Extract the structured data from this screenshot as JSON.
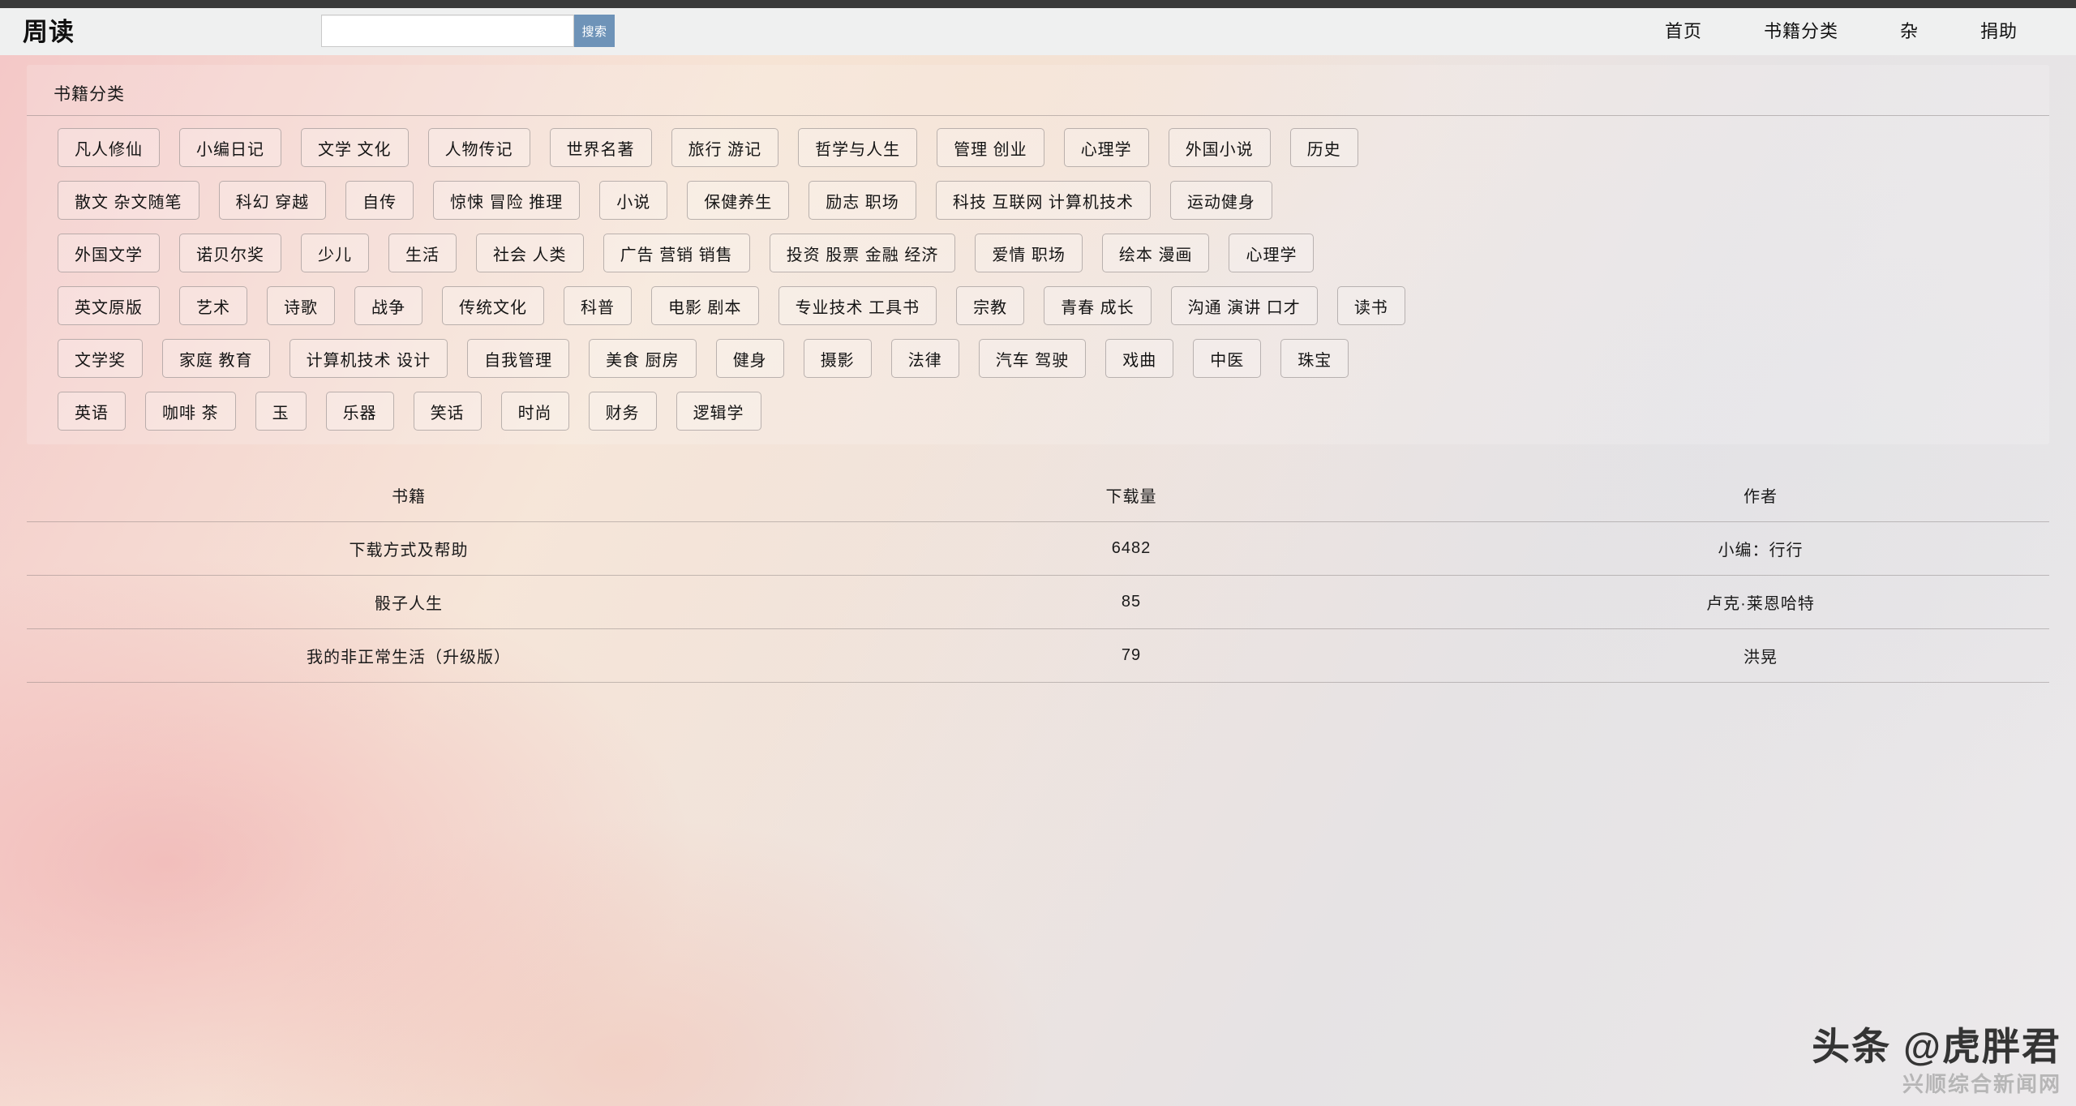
{
  "header": {
    "brand": "周读",
    "search": {
      "value": "",
      "placeholder": "",
      "button_label": "搜索"
    },
    "nav": [
      {
        "label": "首页"
      },
      {
        "label": "书籍分类"
      },
      {
        "label": "杂"
      },
      {
        "label": "捐助"
      }
    ]
  },
  "categories": {
    "title": "书籍分类",
    "rows": [
      [
        "凡人修仙",
        "小编日记",
        "文学 文化",
        "人物传记",
        "世界名著",
        "旅行 游记",
        "哲学与人生",
        "管理 创业",
        "心理学",
        "外国小说",
        "历史"
      ],
      [
        "散文 杂文随笔",
        "科幻 穿越",
        "自传",
        "惊悚 冒险 推理",
        "小说",
        "保健养生",
        "励志 职场",
        "科技 互联网 计算机技术",
        "运动健身"
      ],
      [
        "外国文学",
        "诺贝尔奖",
        "少儿",
        "生活",
        "社会 人类",
        "广告 营销 销售",
        "投资 股票 金融 经济",
        "爱情 职场",
        "绘本 漫画",
        "心理学"
      ],
      [
        "英文原版",
        "艺术",
        "诗歌",
        "战争",
        "传统文化",
        "科普",
        "电影 剧本",
        "专业技术 工具书",
        "宗教",
        "青春 成长",
        "沟通 演讲 口才",
        "读书"
      ],
      [
        "文学奖",
        "家庭 教育",
        "计算机技术 设计",
        "自我管理",
        "美食 厨房",
        "健身",
        "摄影",
        "法律",
        "汽车 驾驶",
        "戏曲",
        "中医",
        "珠宝"
      ],
      [
        "英语",
        "咖啡 茶",
        "玉",
        "乐器",
        "笑话",
        "时尚",
        "财务",
        "逻辑学"
      ]
    ]
  },
  "book_table": {
    "columns": [
      "书籍",
      "下载量",
      "作者"
    ],
    "rows": [
      {
        "book": "下载方式及帮助",
        "downloads": "6482",
        "author": "小编：行行"
      },
      {
        "book": "骰子人生",
        "downloads": "85",
        "author": "卢克·莱恩哈特"
      },
      {
        "book": "我的非正常生活（升级版）",
        "downloads": "79",
        "author": "洪晃"
      }
    ]
  },
  "watermark": {
    "main": "头条 @虎胖君",
    "sub": "兴顺综合新闻网"
  },
  "colors": {
    "top_strip": "#3a3a3a",
    "header_bg": "#eff0f0",
    "search_button": "#6e93b8",
    "text": "#111111"
  }
}
